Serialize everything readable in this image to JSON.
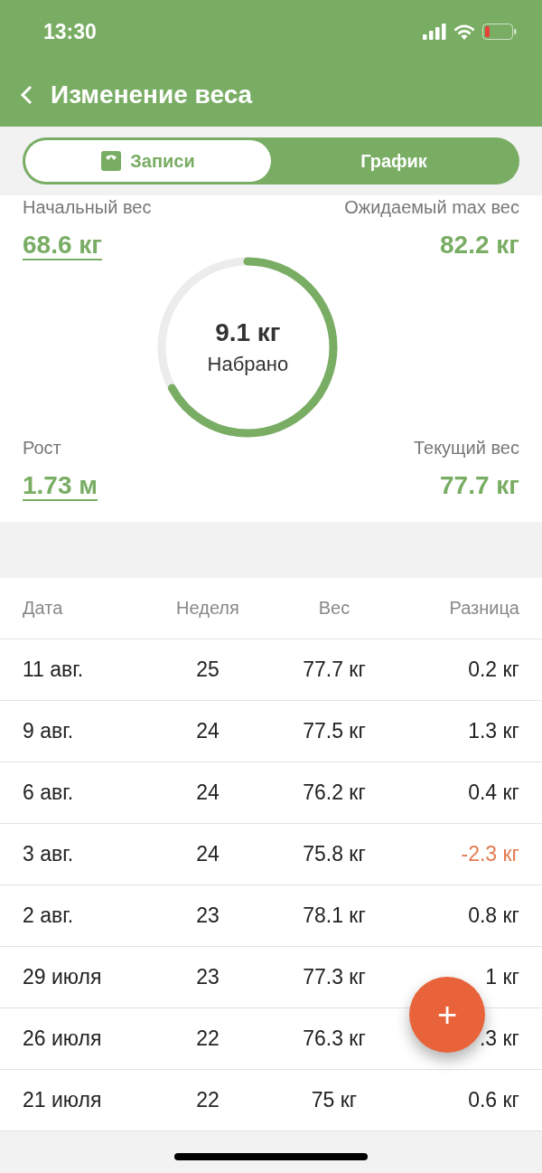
{
  "status_bar": {
    "time": "13:30"
  },
  "header": {
    "title": "Изменение веса"
  },
  "tabs": [
    {
      "label": "Записи",
      "selected": true
    },
    {
      "label": "График",
      "selected": false
    }
  ],
  "summary": {
    "stats": [
      {
        "label": "Начальный вес",
        "value": "68.6 кг",
        "kind": "link"
      },
      {
        "label": "Ожидаемый max вес",
        "value": "82.2 кг",
        "kind": "value"
      },
      {
        "label": "Рост",
        "value": "1.73 м",
        "kind": "link"
      },
      {
        "label": "Текущий вес",
        "value": "77.7 кг",
        "kind": "value"
      }
    ],
    "ring": {
      "value": "9.1 кг",
      "caption": "Набрано"
    }
  },
  "table": {
    "columns": [
      "Дата",
      "Неделя",
      "Вес",
      "Разница"
    ],
    "rows": [
      {
        "date": "11 авг.",
        "week": "25",
        "weight": "77.7 кг",
        "difference": "0.2 кг",
        "negative": false
      },
      {
        "date": "9 авг.",
        "week": "24",
        "weight": "77.5 кг",
        "difference": "1.3 кг",
        "negative": false
      },
      {
        "date": "6 авг.",
        "week": "24",
        "weight": "76.2 кг",
        "difference": "0.4 кг",
        "negative": false
      },
      {
        "date": "3 авг.",
        "week": "24",
        "weight": "75.8 кг",
        "difference": "-2.3 кг",
        "negative": true
      },
      {
        "date": "2 авг.",
        "week": "23",
        "weight": "78.1 кг",
        "difference": "0.8 кг",
        "negative": false
      },
      {
        "date": "29 июля",
        "week": "23",
        "weight": "77.3 кг",
        "difference": "1 кг",
        "negative": false
      },
      {
        "date": "26 июля",
        "week": "22",
        "weight": "76.3 кг",
        "difference": ".3 кг",
        "negative": false
      },
      {
        "date": "21 июля",
        "week": "22",
        "weight": "75 кг",
        "difference": "0.6 кг",
        "negative": false
      }
    ]
  },
  "add_button": {
    "label": "+"
  }
}
